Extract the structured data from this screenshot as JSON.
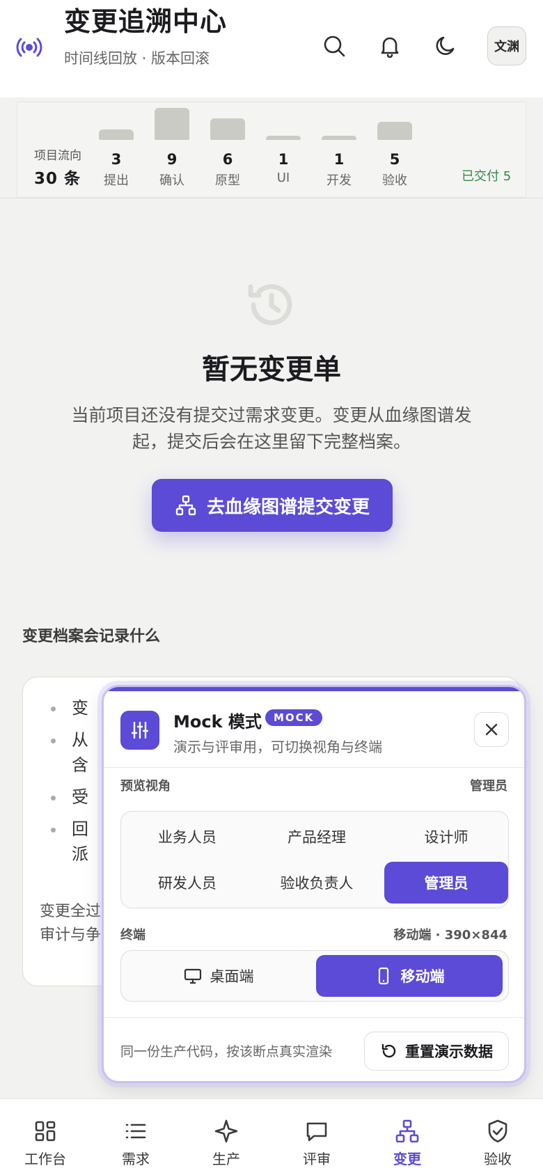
{
  "header": {
    "title": "变更追溯中心",
    "subtitle": "时间线回放 · 版本回滚",
    "avatar": "文渊"
  },
  "flow": {
    "label": "项目流向",
    "count": "30 条",
    "delivered": "已交付 5",
    "stages": [
      {
        "num": "3",
        "label": "提出",
        "level": 0.33
      },
      {
        "num": "9",
        "label": "确认",
        "level": 1.0
      },
      {
        "num": "6",
        "label": "原型",
        "level": 0.67
      },
      {
        "num": "1",
        "label": "UI",
        "level": 0.11
      },
      {
        "num": "1",
        "label": "开发",
        "level": 0.11
      },
      {
        "num": "5",
        "label": "验收",
        "level": 0.56
      }
    ]
  },
  "empty": {
    "title": "暂无变更单",
    "desc": "当前项目还没有提交过需求变更。变更从血缘图谱发起，提交后会在这里留下完整档案。",
    "cta": "去血缘图谱提交变更"
  },
  "archive": {
    "title": "变更档案会记录什么",
    "items": [
      "变",
      "从\n含",
      "受",
      "回\n派"
    ],
    "footer": "变更全过\n审计与争"
  },
  "mock": {
    "title": "Mock 模式",
    "badge": "MOCK",
    "subtitle": "演示与评审用，可切换视角与终端",
    "view_label": "预览视角",
    "view_value": "管理员",
    "roles": [
      "业务人员",
      "产品经理",
      "设计师",
      "研发人员",
      "验收负责人",
      "管理员"
    ],
    "active_role": "管理员",
    "terminal_label": "终端",
    "terminal_value": "移动端 · 390×844",
    "terminals": [
      "桌面端",
      "移动端"
    ],
    "active_terminal": "移动端",
    "footer_text": "同一份生产代码，按该断点真实渲染",
    "reset": "重置演示数据"
  },
  "nav": {
    "items": [
      {
        "label": "工作台",
        "icon": "grid-icon"
      },
      {
        "label": "需求",
        "icon": "list-icon"
      },
      {
        "label": "生产",
        "icon": "sparkle-icon"
      },
      {
        "label": "评审",
        "icon": "chat-icon"
      },
      {
        "label": "变更",
        "icon": "hierarchy-icon"
      },
      {
        "label": "验收",
        "icon": "shield-check-icon"
      }
    ],
    "active": "变更"
  },
  "colors": {
    "accent": "#5b4bd6",
    "delivered": "#2e8a45"
  }
}
